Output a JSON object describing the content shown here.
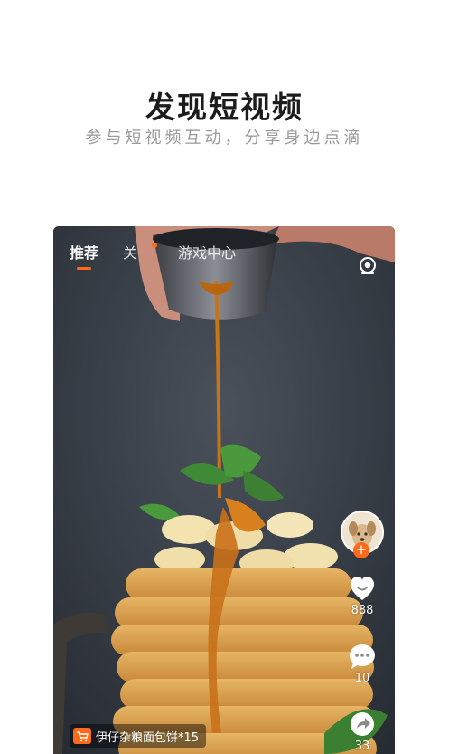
{
  "header": {
    "title": "发现短视频",
    "subtitle": "参与短视频互动，分享身边点滴"
  },
  "video": {
    "tabs": [
      {
        "label": "推荐",
        "active": true
      },
      {
        "label": "关"
      },
      {
        "label": "游戏中心"
      }
    ],
    "actions": {
      "likes": "888",
      "comments": "10",
      "shares": "33"
    },
    "product_tag": "伊仔杂粮面包饼*15"
  },
  "colors": {
    "accent": "#ff6a1a",
    "title": "#1c1c1c",
    "subtitle": "#9a9a9a"
  },
  "icons": [
    "camera-icon",
    "like-heart-icon",
    "comment-icon",
    "share-icon",
    "cart-icon",
    "follow-plus-icon"
  ]
}
